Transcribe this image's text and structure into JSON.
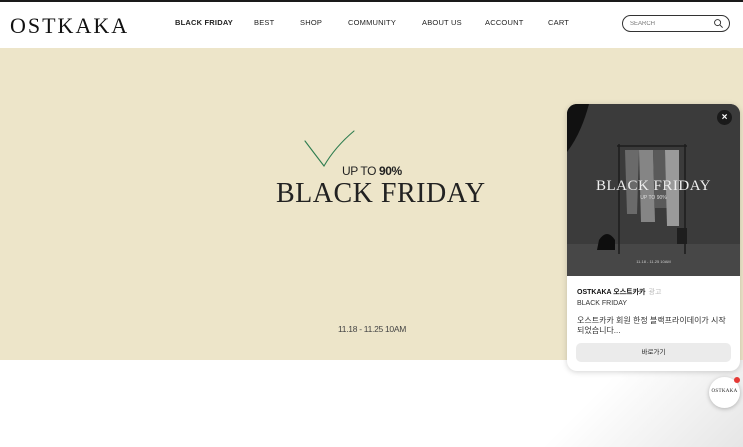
{
  "header": {
    "logo": "OSTKAKA",
    "nav": [
      "BLACK FRIDAY",
      "BEST",
      "SHOP",
      "COMMUNITY",
      "ABOUT US",
      "ACCOUNT",
      "CART"
    ],
    "search_placeholder": "SEARCH"
  },
  "hero": {
    "upto_prefix": "UP TO ",
    "upto_value": "90%",
    "title": "BLACK FRIDAY",
    "dates": "11.18 - 11.25 10AM"
  },
  "popup": {
    "image_title": "BLACK FRIDAY",
    "image_sub": "UP TO 90%",
    "image_dates": "11.18 - 11.25 10AM",
    "close_label": "×",
    "brand": "OSTKAKA 오스트카카",
    "ad_label": "광고",
    "subtitle": "BLACK FRIDAY",
    "description": "오스트카카 회원 한정 블랙프라이데이가 시작되었습니다...",
    "button_label": "바로가기"
  },
  "fab": {
    "label": "OSTKAKA"
  },
  "colors": {
    "hero_bg": "#ede5c9",
    "accent_check": "#2e7d4f",
    "notification_dot": "#e53935"
  },
  "icons": [
    "search-icon",
    "close-icon",
    "check-mark-icon"
  ]
}
